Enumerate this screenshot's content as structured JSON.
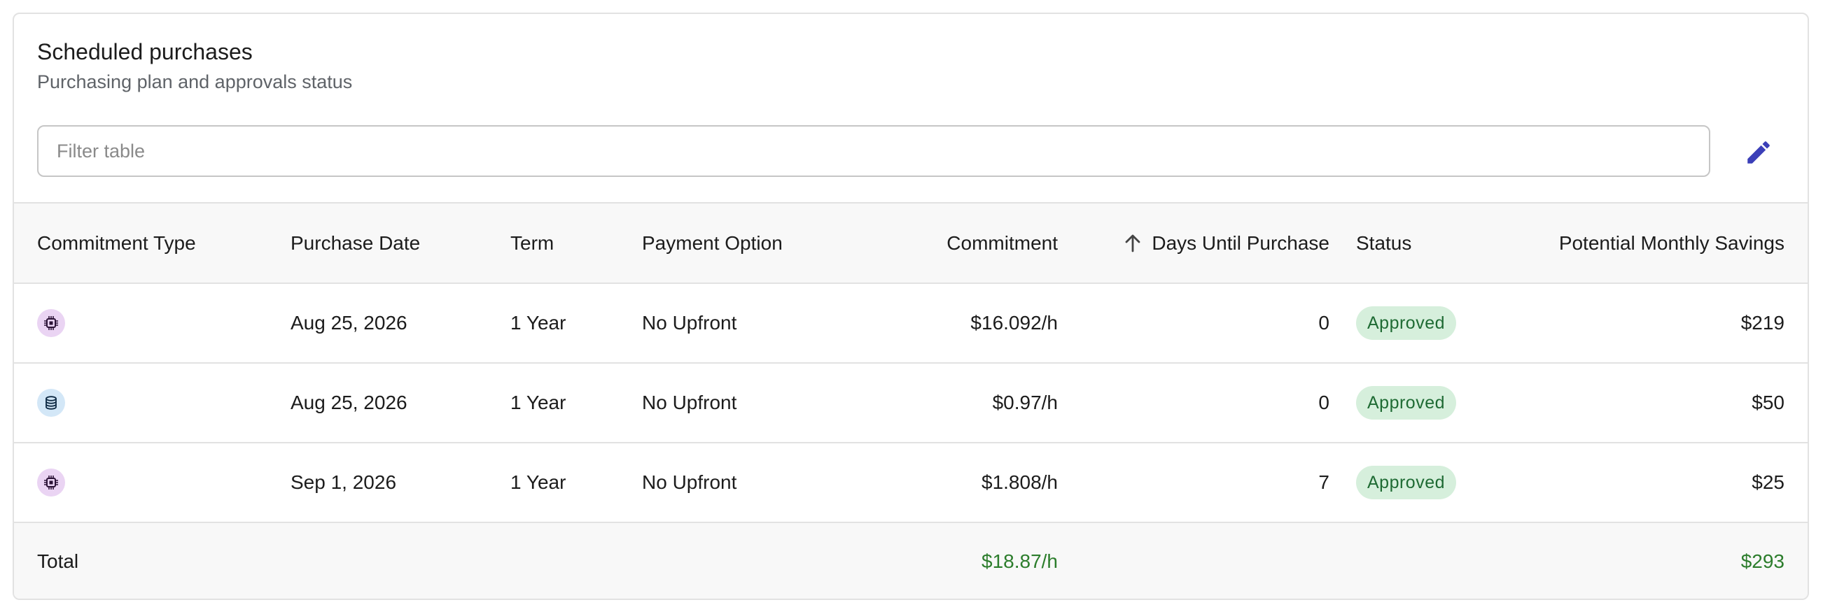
{
  "header": {
    "title": "Scheduled purchases",
    "subtitle": "Purchasing plan and approvals status"
  },
  "filter": {
    "placeholder": "Filter table",
    "value": ""
  },
  "edit_icon": "pencil-icon",
  "table": {
    "columns": [
      "Commitment Type",
      "Purchase Date",
      "Term",
      "Payment Option",
      "Commitment",
      "Days Until Purchase",
      "Status",
      "Potential Monthly Savings"
    ],
    "sorted_column": "Days Until Purchase",
    "sort_direction": "ascending",
    "rows": [
      {
        "type_icon": "compute-chip-icon",
        "purchase_date": "Aug 25, 2026",
        "term": "1 Year",
        "payment_option": "No Upfront",
        "commitment": "$16.092/h",
        "days_until_purchase": "0",
        "status": "Approved",
        "savings": "$219"
      },
      {
        "type_icon": "database-icon",
        "purchase_date": "Aug 25, 2026",
        "term": "1 Year",
        "payment_option": "No Upfront",
        "commitment": "$0.97/h",
        "days_until_purchase": "0",
        "status": "Approved",
        "savings": "$50"
      },
      {
        "type_icon": "compute-chip-icon",
        "purchase_date": "Sep 1, 2026",
        "term": "1 Year",
        "payment_option": "No Upfront",
        "commitment": "$1.808/h",
        "days_until_purchase": "7",
        "status": "Approved",
        "savings": "$25"
      }
    ],
    "total": {
      "label": "Total",
      "commitment": "$18.87/h",
      "savings": "$293"
    }
  },
  "colors": {
    "accent": "#3b3fb8",
    "approved_bg": "#d6efdc",
    "approved_text": "#1f6b34",
    "total_green": "#2c7d2c",
    "compute_icon_bg": "#ead4f3",
    "database_icon_bg": "#d3e7f7"
  }
}
